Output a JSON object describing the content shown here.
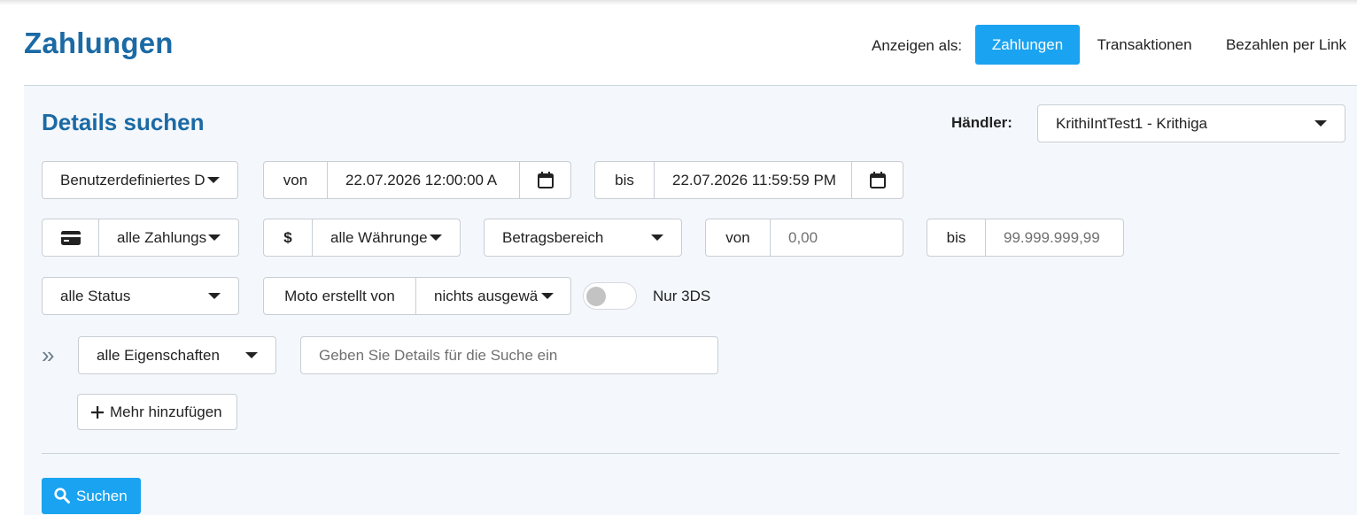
{
  "page": {
    "title": "Zahlungen"
  },
  "view_switch": {
    "label": "Anzeigen als:",
    "options": [
      {
        "label": "Zahlungen",
        "active": true
      },
      {
        "label": "Transaktionen",
        "active": false
      },
      {
        "label": "Bezahlen per Link",
        "active": false
      }
    ]
  },
  "search": {
    "title": "Details suchen",
    "merchant": {
      "label": "Händler:",
      "value": "KrithiIntTest1 - Krithiga"
    },
    "date_range": {
      "preset": "Benutzerdefiniertes D",
      "from_label": "von",
      "from_value": "22.07.2026 12:00:00 A",
      "to_label": "bis",
      "to_value": "22.07.2026 11:59:59 PM"
    },
    "payment_type": {
      "icon": "credit-card-icon",
      "value": "alle Zahlungs"
    },
    "currency": {
      "icon": "dollar-icon",
      "symbol": "$",
      "value": "alle Währunge"
    },
    "amount": {
      "mode": "Betragsbereich",
      "from_label": "von",
      "from_placeholder": "0,00",
      "to_label": "bis",
      "to_placeholder": "99.999.999,99"
    },
    "status": {
      "value": "alle Status"
    },
    "moto": {
      "label": "Moto erstellt von",
      "value": "nichts ausgewä"
    },
    "three_ds": {
      "label": "Nur 3DS",
      "enabled": false
    },
    "property": {
      "value": "alle Eigenschaften",
      "placeholder": "Geben Sie Details für die Suche ein"
    },
    "add_more_label": "Mehr hinzufügen",
    "submit_label": "Suchen"
  },
  "colors": {
    "primary": "#1aa3f0",
    "title": "#1b6aa5",
    "panel_bg": "#f4f8fc",
    "border": "#c8ced4"
  }
}
